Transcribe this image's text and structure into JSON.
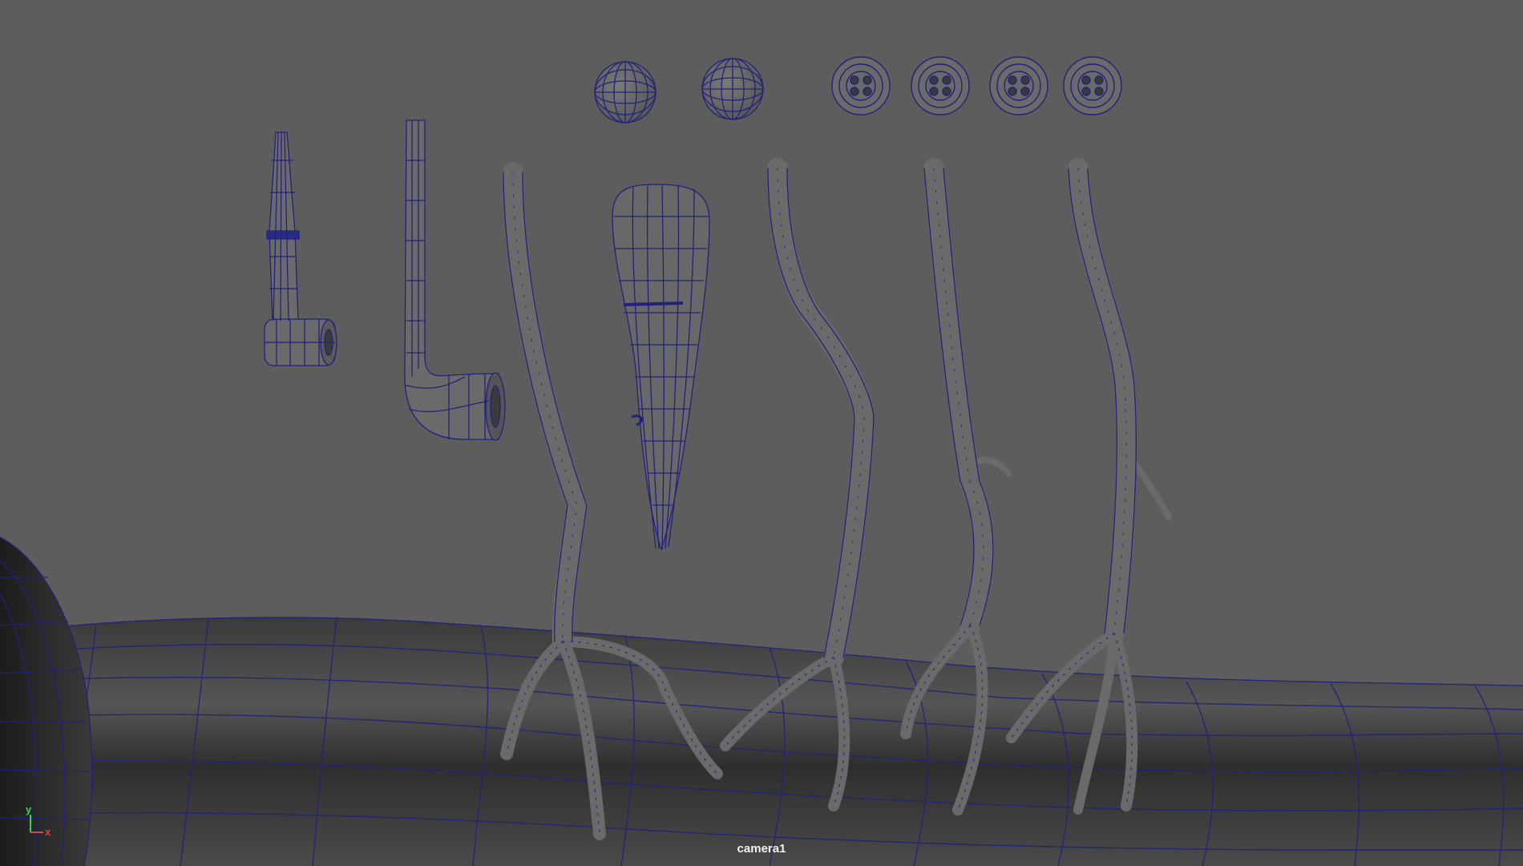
{
  "viewport": {
    "camera_label": "camera1",
    "background_color": "#5d5d5d",
    "wire_color": "#22227a"
  },
  "axis_gizmo": {
    "y_label": "y",
    "x_label": "x",
    "y_color": "#39d353",
    "x_color": "#e04040"
  },
  "scene_objects": [
    "pipe-small-model",
    "pipe-long-model",
    "eyeball-model-1",
    "eyeball-model-2",
    "button-model-1",
    "button-model-2",
    "button-model-3",
    "button-model-4",
    "carrot-nose-model",
    "branch-arm-model-1",
    "branch-arm-model-2",
    "branch-arm-model-3",
    "branch-arm-model-4",
    "ground-surface-model",
    "snowball-body-model"
  ]
}
